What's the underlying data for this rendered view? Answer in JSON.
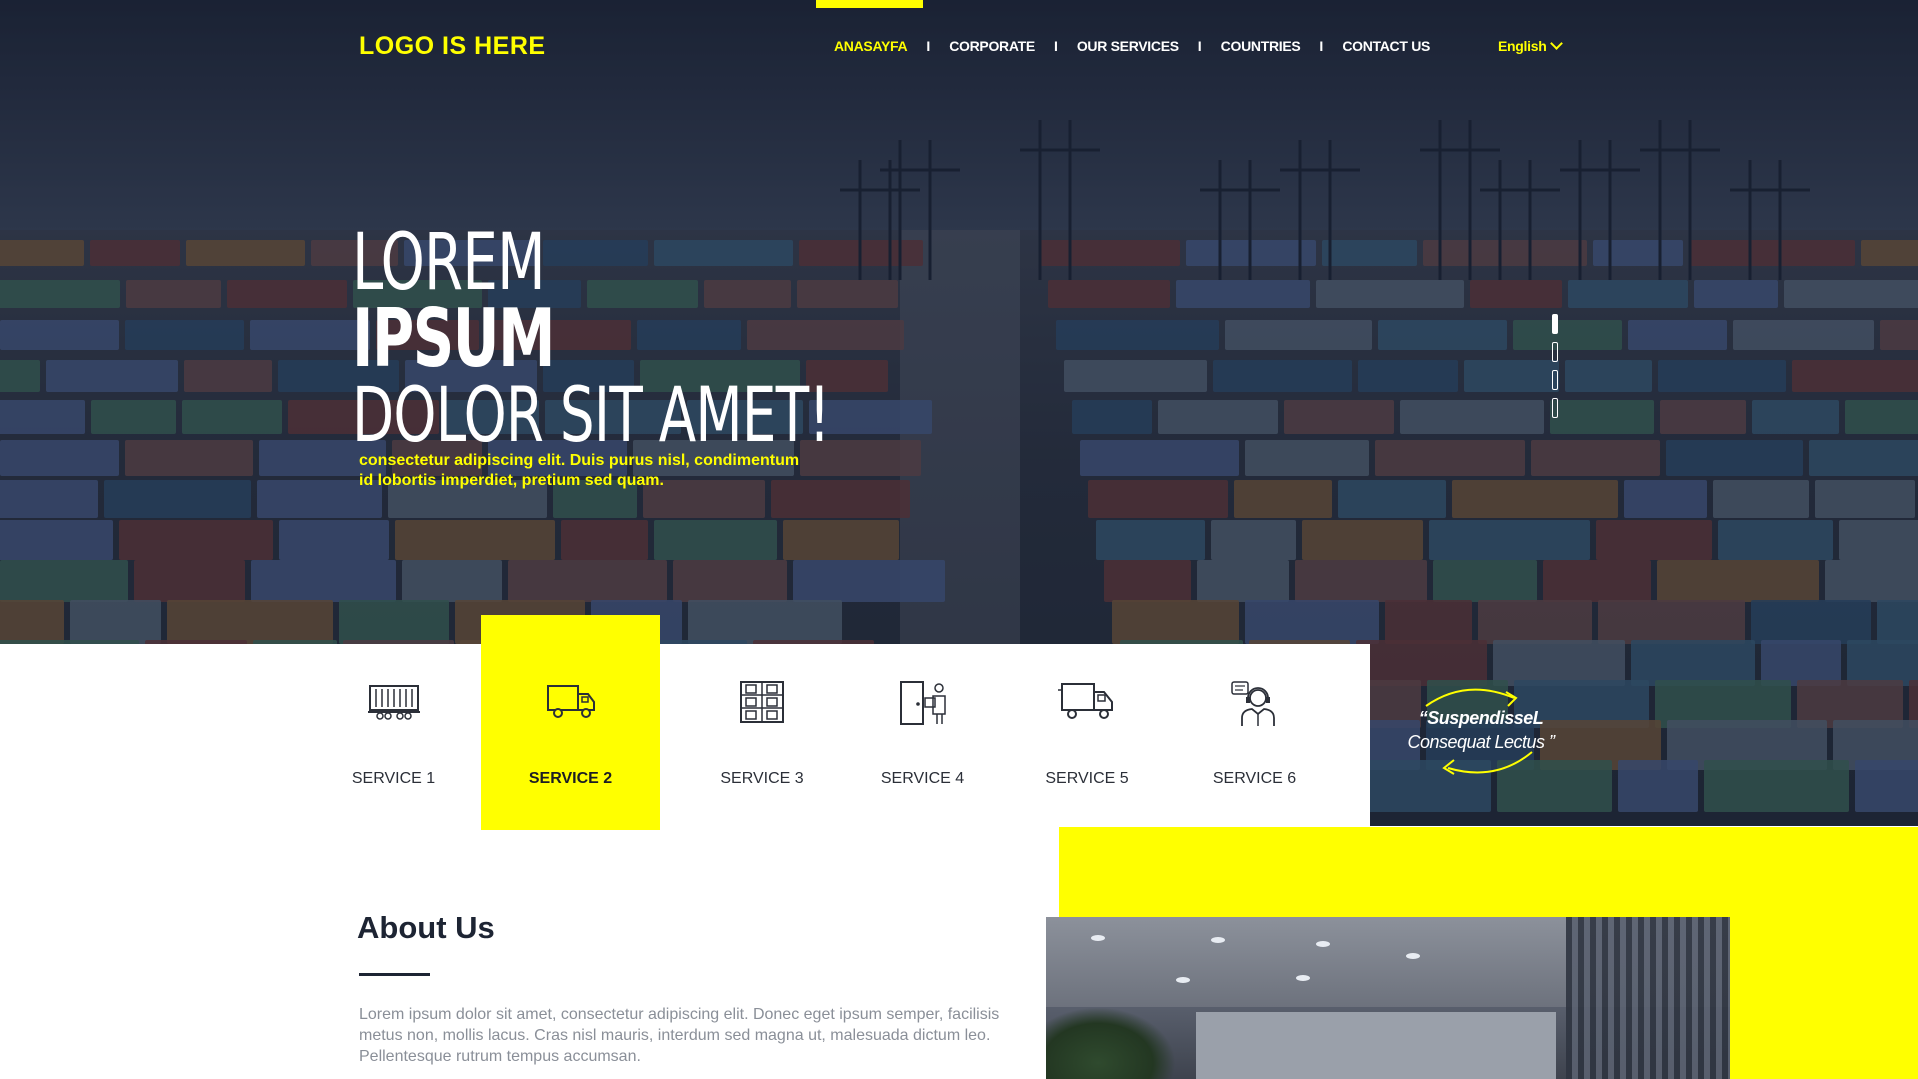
{
  "colors": {
    "accent": "#ffff00",
    "dark": "#1d2433",
    "hero_overlay": "#1f2a3e"
  },
  "header": {
    "logo": "LOGO IS HERE",
    "nav": [
      {
        "label": "ANASAYFA",
        "active": true
      },
      {
        "label": "CORPORATE",
        "active": false
      },
      {
        "label": "OUR SERVICES",
        "active": false
      },
      {
        "label": "COUNTRIES",
        "active": false
      },
      {
        "label": "CONTACT US",
        "active": false
      }
    ],
    "nav_separator": "I",
    "language": "English"
  },
  "hero": {
    "line1": "LOREM",
    "line2": "IPSUM",
    "line3": "DOLOR SIT AMET!",
    "subtitle": "consectetur adipiscing elit. Duis purus nisl, condimentum id lobortis imperdiet, pretium sed quam.",
    "slides": 4,
    "active_slide": 1
  },
  "services": [
    {
      "label": "SERVICE 1",
      "icon": "railcar-icon",
      "active": false
    },
    {
      "label": "SERVICE 2",
      "icon": "truck-icon",
      "active": true
    },
    {
      "label": "SERVICE 3",
      "icon": "warehouse-shelves-icon",
      "active": false
    },
    {
      "label": "SERVICE 4",
      "icon": "delivery-door-icon",
      "active": false
    },
    {
      "label": "SERVICE 5",
      "icon": "delivery-truck-icon",
      "active": false
    },
    {
      "label": "SERVICE 6",
      "icon": "support-agent-icon",
      "active": false
    }
  ],
  "quote": {
    "line1": "“SuspendisseL",
    "line2": "Consequat Lectus ”"
  },
  "about": {
    "title": "About Us",
    "text": "Lorem ipsum dolor sit amet, consectetur adipiscing elit. Donec eget ipsum semper, facilisis metus non, mollis lacus. Cras nisl mauris, interdum sed magna ut, malesuada dictum leo. Pellentesque rutrum tempus accumsan."
  }
}
